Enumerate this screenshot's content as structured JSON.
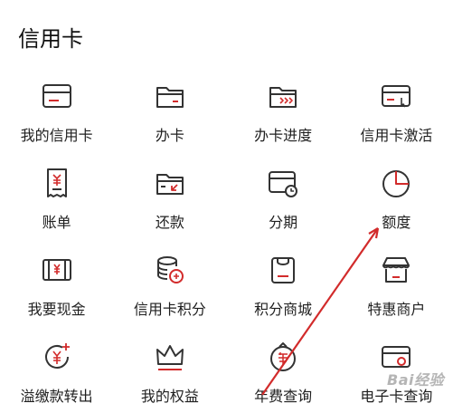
{
  "section": {
    "title": "信用卡"
  },
  "colors": {
    "accent": "#d22b2b",
    "icon_stroke": "#333333",
    "text": "#1f1f1f"
  },
  "items": [
    {
      "label": "我的信用卡",
      "icon": "credit-card-icon"
    },
    {
      "label": "办卡",
      "icon": "card-folder-icon"
    },
    {
      "label": "办卡进度",
      "icon": "card-progress-icon"
    },
    {
      "label": "信用卡激活",
      "icon": "card-activate-icon"
    },
    {
      "label": "账单",
      "icon": "bill-icon"
    },
    {
      "label": "还款",
      "icon": "repay-icon"
    },
    {
      "label": "分期",
      "icon": "installment-icon"
    },
    {
      "label": "额度",
      "icon": "pie-chart-icon"
    },
    {
      "label": "我要现金",
      "icon": "cash-icon"
    },
    {
      "label": "信用卡积分",
      "icon": "coins-icon"
    },
    {
      "label": "积分商城",
      "icon": "shopping-bag-icon"
    },
    {
      "label": "特惠商户",
      "icon": "storefront-icon"
    },
    {
      "label": "溢缴款转出",
      "icon": "yen-transfer-icon"
    },
    {
      "label": "我的权益",
      "icon": "crown-icon"
    },
    {
      "label": "年费查询",
      "icon": "annual-fee-icon"
    },
    {
      "label": "电子卡查询",
      "icon": "e-card-icon"
    }
  ],
  "watermark": "Bai经验"
}
